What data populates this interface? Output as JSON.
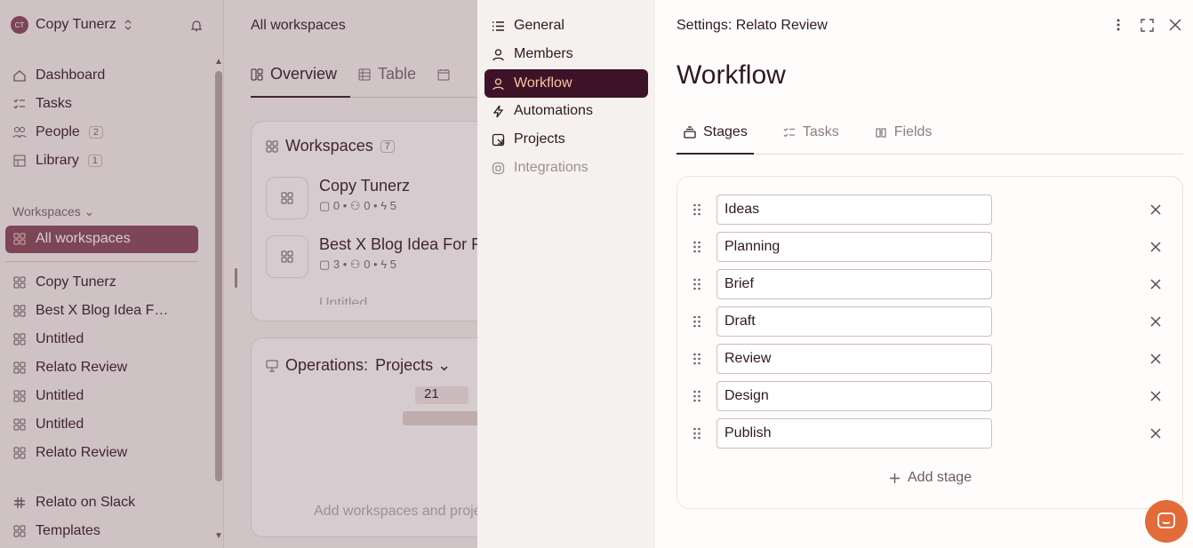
{
  "sidebar": {
    "workspace_initials": "CT",
    "workspace_name": "Copy Tunerz",
    "nav": [
      {
        "label": "Dashboard"
      },
      {
        "label": "Tasks"
      },
      {
        "label": "People",
        "badge": "2"
      },
      {
        "label": "Library",
        "badge": "1"
      }
    ],
    "section_label": "Workspaces",
    "active_item": "All workspaces",
    "workspaces": [
      "Copy Tunerz",
      "Best X Blog Idea F…",
      "Untitled",
      "Relato Review",
      "Untitled",
      "Untitled",
      "Relato Review"
    ],
    "footer": [
      "Relato on Slack",
      "Templates"
    ]
  },
  "main": {
    "title": "All workspaces",
    "tabs": [
      "Overview",
      "Table"
    ],
    "workspaces_card": {
      "title": "Workspaces",
      "count": "7",
      "rows": [
        {
          "name": "Copy Tunerz",
          "tasks": "0",
          "people": "0",
          "automations": "5"
        },
        {
          "name": "Best X Blog Idea For R",
          "tasks": "3",
          "people": "0",
          "automations": "5"
        }
      ],
      "partial": "Untitled"
    },
    "operations_card": {
      "title": "Operations:",
      "selector": "Projects",
      "calendar_day": "21",
      "empty_text": "Add workspaces and proje"
    }
  },
  "settings_nav": [
    {
      "label": "General"
    },
    {
      "label": "Members"
    },
    {
      "label": "Workflow"
    },
    {
      "label": "Automations"
    },
    {
      "label": "Projects"
    },
    {
      "label": "Integrations"
    }
  ],
  "settings": {
    "title": "Settings: Relato Review",
    "page_title": "Workflow",
    "tabs": [
      "Stages",
      "Tasks",
      "Fields"
    ],
    "stages": [
      "Ideas",
      "Planning",
      "Brief",
      "Draft",
      "Review",
      "Design",
      "Publish"
    ],
    "add_stage_label": "Add stage"
  },
  "colors": {
    "active_nav_bg": "#3e1227",
    "active_nav_text": "#f5c6a0",
    "sidebar_active_bg": "#8a4c5f",
    "chat_button": "#e26b39"
  }
}
